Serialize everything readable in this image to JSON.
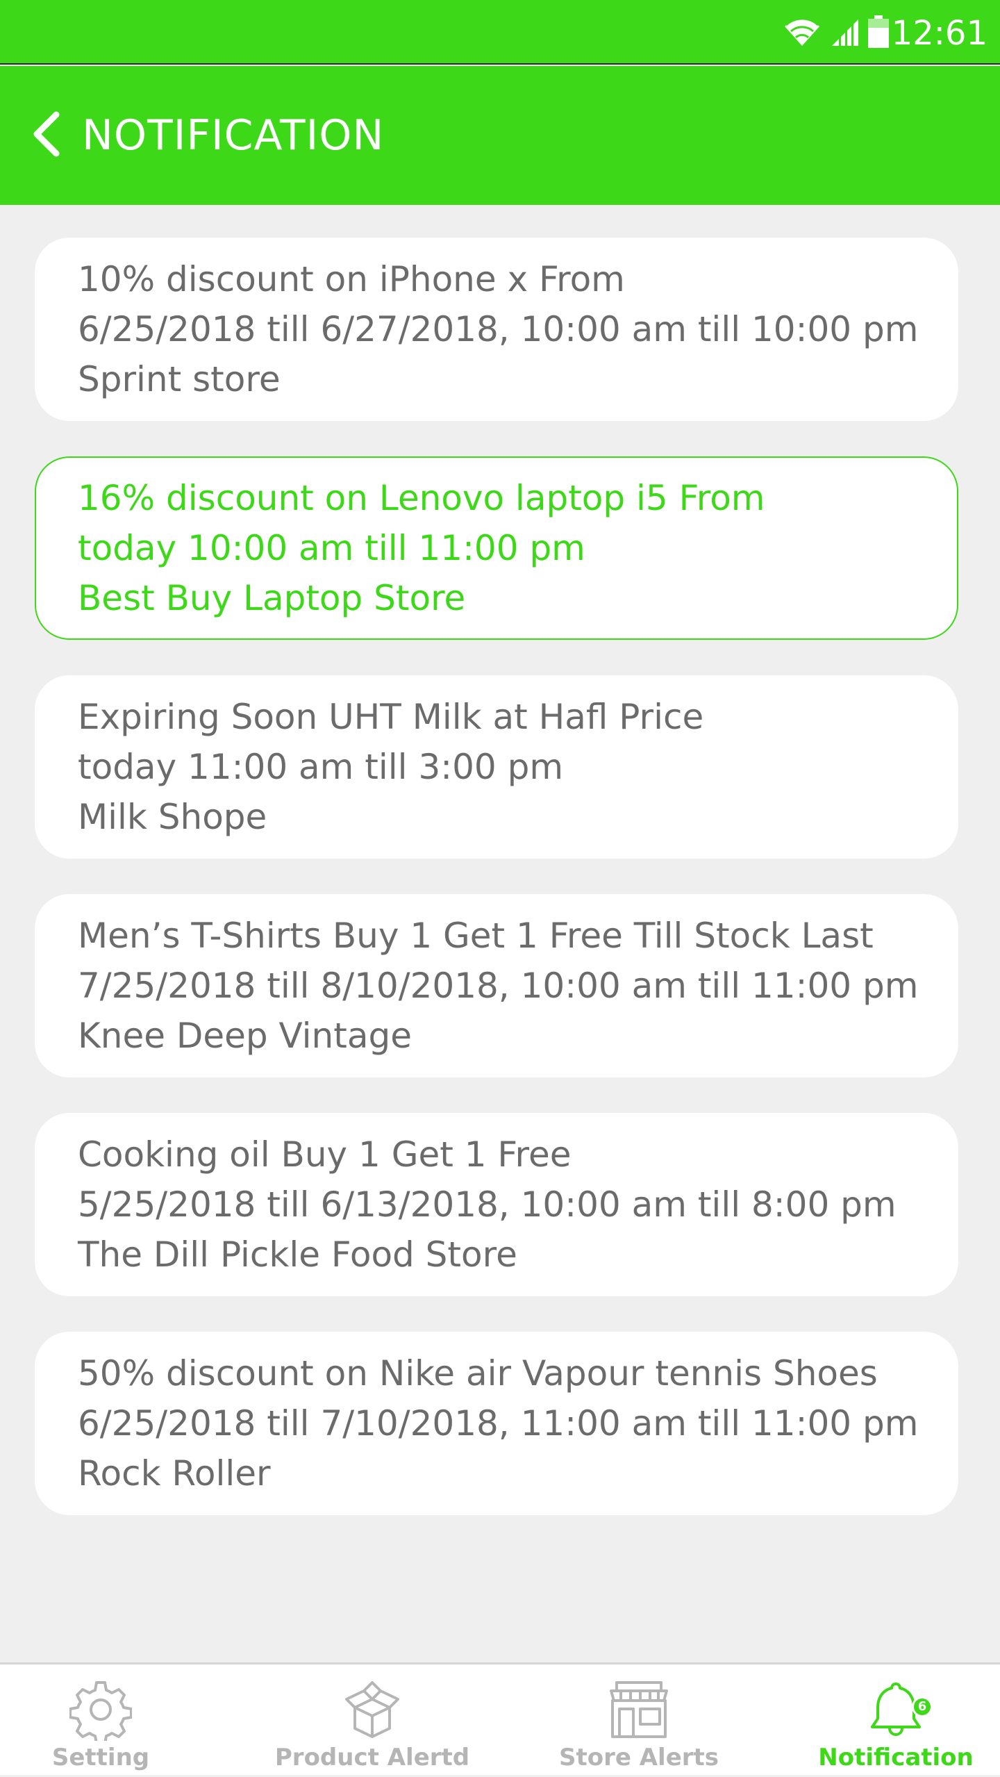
{
  "status_bar": {
    "time": "12:61",
    "icons": [
      "wifi-icon",
      "signal-icon",
      "battery-icon"
    ]
  },
  "app_bar": {
    "title": "NOTIFICATION",
    "back_icon": "chevron-left-icon"
  },
  "notifications": [
    {
      "title": "10% discount on iPhone x From",
      "time": "6/25/2018 till 6/27/2018, 10:00 am till 10:00 pm",
      "store": "Sprint store",
      "highlighted": false
    },
    {
      "title": "16% discount on Lenovo laptop i5 From",
      "time": "today 10:00 am till 11:00 pm",
      "store": "Best Buy Laptop Store",
      "highlighted": true
    },
    {
      "title": "Expiring Soon UHT Milk at Hafl Price",
      "time": "today 11:00 am till 3:00 pm",
      "store": "Milk Shope",
      "highlighted": false
    },
    {
      "title": "Men’s T-Shirts Buy 1 Get 1 Free Till Stock Last",
      "time": "7/25/2018 till 8/10/2018, 10:00 am till 11:00 pm",
      "store": "Knee Deep Vintage",
      "highlighted": false
    },
    {
      "title": "Cooking oil Buy 1 Get 1 Free",
      "time": "5/25/2018 till 6/13/2018, 10:00 am till 8:00 pm",
      "store": "The Dill Pickle Food Store",
      "highlighted": false
    },
    {
      "title": "50% discount on Nike air Vapour tennis Shoes",
      "time": "6/25/2018 till 7/10/2018, 11:00 am till 11:00 pm",
      "store": "Rock Roller",
      "highlighted": false
    }
  ],
  "tabs": [
    {
      "label": "Setting",
      "icon": "gear-icon",
      "active": false
    },
    {
      "label": "Product Alertd",
      "icon": "box-icon",
      "active": false
    },
    {
      "label": "Store Alerts",
      "icon": "store-icon",
      "active": false
    },
    {
      "label": "Notification",
      "icon": "bell-icon",
      "active": true,
      "badge": "6"
    }
  ],
  "colors": {
    "accent": "#3dd817",
    "text_muted": "#6b6b6b",
    "tab_inactive": "#b5b5b5",
    "background": "#efefef"
  }
}
